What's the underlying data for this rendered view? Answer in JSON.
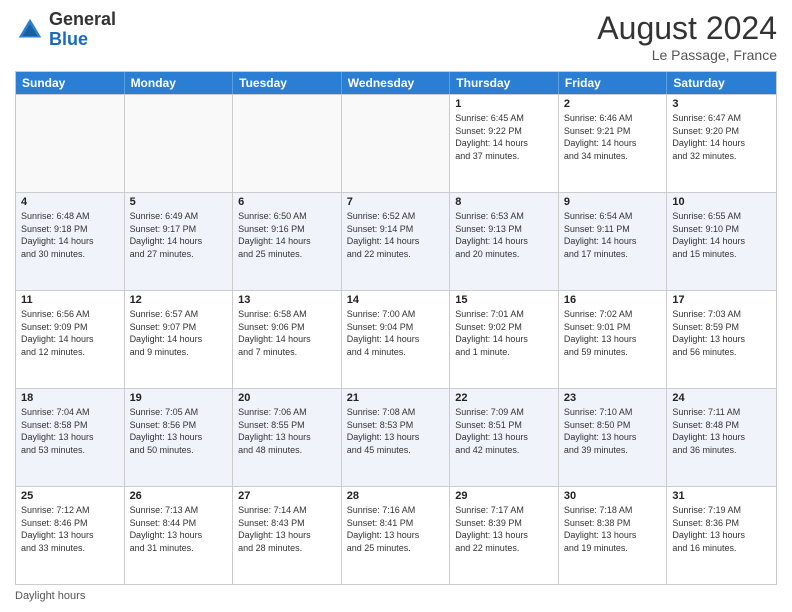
{
  "header": {
    "logo_general": "General",
    "logo_blue": "Blue",
    "month_year": "August 2024",
    "location": "Le Passage, France"
  },
  "footer": {
    "label": "Daylight hours"
  },
  "days_of_week": [
    "Sunday",
    "Monday",
    "Tuesday",
    "Wednesday",
    "Thursday",
    "Friday",
    "Saturday"
  ],
  "rows": [
    [
      {
        "day": "",
        "info": ""
      },
      {
        "day": "",
        "info": ""
      },
      {
        "day": "",
        "info": ""
      },
      {
        "day": "",
        "info": ""
      },
      {
        "day": "1",
        "info": "Sunrise: 6:45 AM\nSunset: 9:22 PM\nDaylight: 14 hours\nand 37 minutes."
      },
      {
        "day": "2",
        "info": "Sunrise: 6:46 AM\nSunset: 9:21 PM\nDaylight: 14 hours\nand 34 minutes."
      },
      {
        "day": "3",
        "info": "Sunrise: 6:47 AM\nSunset: 9:20 PM\nDaylight: 14 hours\nand 32 minutes."
      }
    ],
    [
      {
        "day": "4",
        "info": "Sunrise: 6:48 AM\nSunset: 9:18 PM\nDaylight: 14 hours\nand 30 minutes."
      },
      {
        "day": "5",
        "info": "Sunrise: 6:49 AM\nSunset: 9:17 PM\nDaylight: 14 hours\nand 27 minutes."
      },
      {
        "day": "6",
        "info": "Sunrise: 6:50 AM\nSunset: 9:16 PM\nDaylight: 14 hours\nand 25 minutes."
      },
      {
        "day": "7",
        "info": "Sunrise: 6:52 AM\nSunset: 9:14 PM\nDaylight: 14 hours\nand 22 minutes."
      },
      {
        "day": "8",
        "info": "Sunrise: 6:53 AM\nSunset: 9:13 PM\nDaylight: 14 hours\nand 20 minutes."
      },
      {
        "day": "9",
        "info": "Sunrise: 6:54 AM\nSunset: 9:11 PM\nDaylight: 14 hours\nand 17 minutes."
      },
      {
        "day": "10",
        "info": "Sunrise: 6:55 AM\nSunset: 9:10 PM\nDaylight: 14 hours\nand 15 minutes."
      }
    ],
    [
      {
        "day": "11",
        "info": "Sunrise: 6:56 AM\nSunset: 9:09 PM\nDaylight: 14 hours\nand 12 minutes."
      },
      {
        "day": "12",
        "info": "Sunrise: 6:57 AM\nSunset: 9:07 PM\nDaylight: 14 hours\nand 9 minutes."
      },
      {
        "day": "13",
        "info": "Sunrise: 6:58 AM\nSunset: 9:06 PM\nDaylight: 14 hours\nand 7 minutes."
      },
      {
        "day": "14",
        "info": "Sunrise: 7:00 AM\nSunset: 9:04 PM\nDaylight: 14 hours\nand 4 minutes."
      },
      {
        "day": "15",
        "info": "Sunrise: 7:01 AM\nSunset: 9:02 PM\nDaylight: 14 hours\nand 1 minute."
      },
      {
        "day": "16",
        "info": "Sunrise: 7:02 AM\nSunset: 9:01 PM\nDaylight: 13 hours\nand 59 minutes."
      },
      {
        "day": "17",
        "info": "Sunrise: 7:03 AM\nSunset: 8:59 PM\nDaylight: 13 hours\nand 56 minutes."
      }
    ],
    [
      {
        "day": "18",
        "info": "Sunrise: 7:04 AM\nSunset: 8:58 PM\nDaylight: 13 hours\nand 53 minutes."
      },
      {
        "day": "19",
        "info": "Sunrise: 7:05 AM\nSunset: 8:56 PM\nDaylight: 13 hours\nand 50 minutes."
      },
      {
        "day": "20",
        "info": "Sunrise: 7:06 AM\nSunset: 8:55 PM\nDaylight: 13 hours\nand 48 minutes."
      },
      {
        "day": "21",
        "info": "Sunrise: 7:08 AM\nSunset: 8:53 PM\nDaylight: 13 hours\nand 45 minutes."
      },
      {
        "day": "22",
        "info": "Sunrise: 7:09 AM\nSunset: 8:51 PM\nDaylight: 13 hours\nand 42 minutes."
      },
      {
        "day": "23",
        "info": "Sunrise: 7:10 AM\nSunset: 8:50 PM\nDaylight: 13 hours\nand 39 minutes."
      },
      {
        "day": "24",
        "info": "Sunrise: 7:11 AM\nSunset: 8:48 PM\nDaylight: 13 hours\nand 36 minutes."
      }
    ],
    [
      {
        "day": "25",
        "info": "Sunrise: 7:12 AM\nSunset: 8:46 PM\nDaylight: 13 hours\nand 33 minutes."
      },
      {
        "day": "26",
        "info": "Sunrise: 7:13 AM\nSunset: 8:44 PM\nDaylight: 13 hours\nand 31 minutes."
      },
      {
        "day": "27",
        "info": "Sunrise: 7:14 AM\nSunset: 8:43 PM\nDaylight: 13 hours\nand 28 minutes."
      },
      {
        "day": "28",
        "info": "Sunrise: 7:16 AM\nSunset: 8:41 PM\nDaylight: 13 hours\nand 25 minutes."
      },
      {
        "day": "29",
        "info": "Sunrise: 7:17 AM\nSunset: 8:39 PM\nDaylight: 13 hours\nand 22 minutes."
      },
      {
        "day": "30",
        "info": "Sunrise: 7:18 AM\nSunset: 8:38 PM\nDaylight: 13 hours\nand 19 minutes."
      },
      {
        "day": "31",
        "info": "Sunrise: 7:19 AM\nSunset: 8:36 PM\nDaylight: 13 hours\nand 16 minutes."
      }
    ]
  ]
}
